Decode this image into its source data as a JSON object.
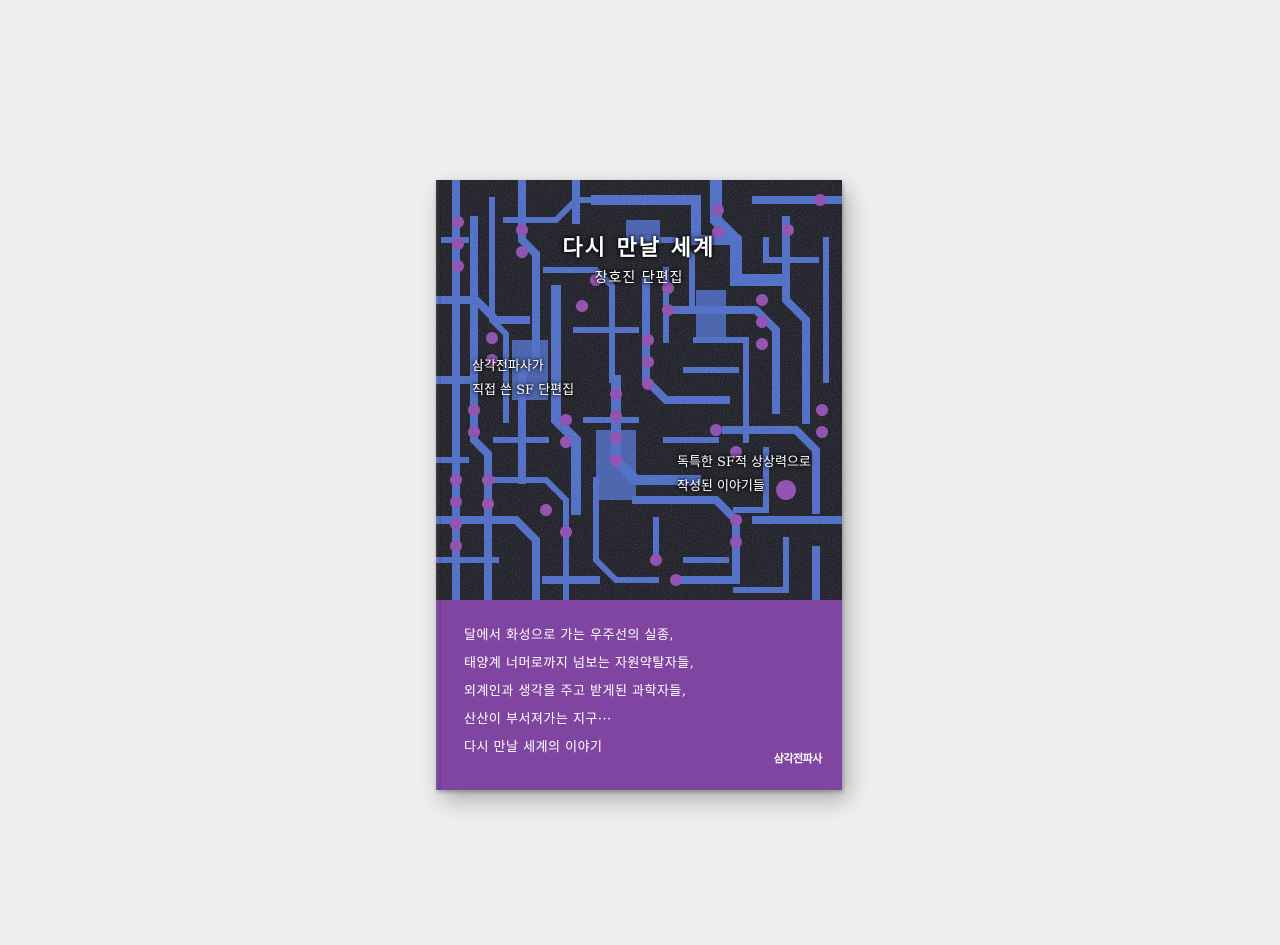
{
  "cover": {
    "title": "다시 만날 세계",
    "subtitle": "장호진 단편집",
    "tagline_left": [
      "삼각전파사가",
      "직접 쓴 SF 단편집"
    ],
    "tagline_right": [
      "독특한 SF적 상상력으로",
      "작성된 이야기들"
    ],
    "blurb": [
      "달에서 화성으로 가는 우주선의 실종,",
      "태양계 너머로까지 넘보는 자원약탈자들,",
      "외계인과 생각을 주고 받게된 과학자들,",
      "산산이 부서져가는 지구···",
      "다시 만날 세계의 이야기"
    ],
    "publisher": "삼각전파사"
  },
  "colors": {
    "background": "#efefef",
    "cover_dark": "#0a0a14",
    "trace_blue": "#3f63c8",
    "pad_purple": "#8a3fb0",
    "band_purple": "#7f45a0"
  }
}
